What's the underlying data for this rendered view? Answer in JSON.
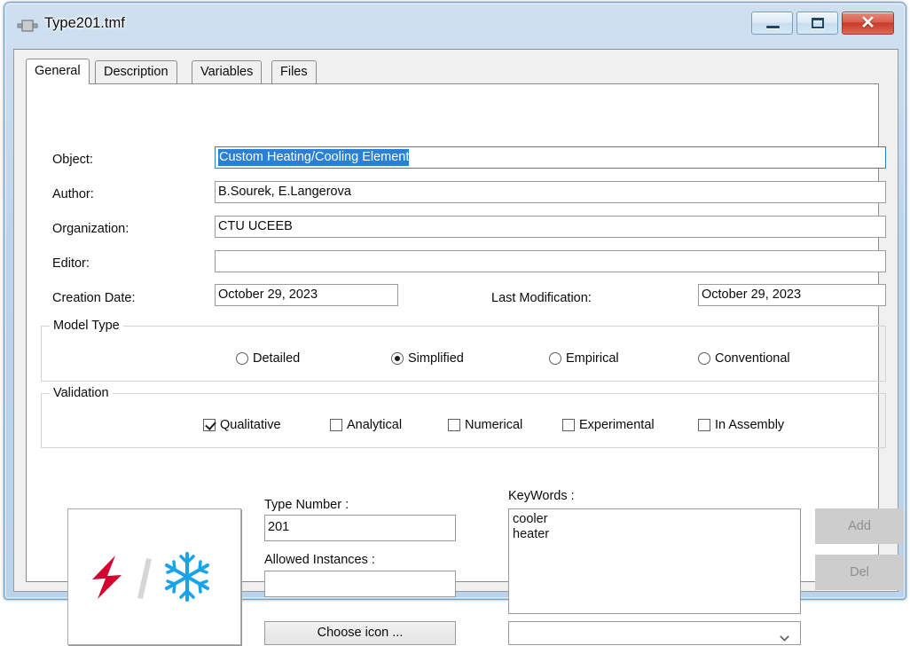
{
  "window": {
    "title": "Type201.tmf",
    "icon": "trnsys-type-icon",
    "controls": {
      "minimize": "minimize-button",
      "maximize": "maximize-button",
      "close_glyph": "✕"
    }
  },
  "tabs": [
    {
      "label": "General",
      "active": true
    },
    {
      "label": "Description",
      "active": false
    },
    {
      "label": "Variables",
      "active": false
    },
    {
      "label": "Files",
      "active": false
    }
  ],
  "fields": {
    "object": {
      "label": "Object:",
      "value": "Custom Heating/Cooling Element",
      "selected": true,
      "focused": true
    },
    "author": {
      "label": "Author:",
      "value": "B.Sourek, E.Langerova"
    },
    "organization": {
      "label": "Organization:",
      "value": "CTU UCEEB"
    },
    "editor": {
      "label": "Editor:",
      "value": ""
    },
    "creation_date": {
      "label": "Creation Date:",
      "value": "October 29, 2023"
    },
    "last_modification": {
      "label": "Last Modification:",
      "value": "October 29, 2023"
    }
  },
  "model_type": {
    "title": "Model Type",
    "options": [
      {
        "label": "Detailed",
        "checked": false
      },
      {
        "label": "Simplified",
        "checked": true
      },
      {
        "label": "Empirical",
        "checked": false
      },
      {
        "label": "Conventional",
        "checked": false
      }
    ]
  },
  "validation": {
    "title": "Validation",
    "options": [
      {
        "label": "Qualitative",
        "checked": true
      },
      {
        "label": "Analytical",
        "checked": false
      },
      {
        "label": "Numerical",
        "checked": false
      },
      {
        "label": "Experimental",
        "checked": false
      },
      {
        "label": "In Assembly",
        "checked": false
      }
    ]
  },
  "icon_panel": {
    "choose_button": "Choose icon ...",
    "art": {
      "bolt": "lightning-bolt-icon",
      "slash": "slash-divider-icon",
      "snowflake": "snowflake-icon"
    }
  },
  "type_number": {
    "label": "Type Number :",
    "value": "201"
  },
  "allowed_instances": {
    "label": "Allowed Instances :",
    "value": ""
  },
  "keywords": {
    "label": "KeyWords :",
    "items": [
      "cooler",
      "heater"
    ],
    "combo_value": "",
    "add_button": "Add",
    "del_button": "Del",
    "add_enabled": false,
    "del_enabled": false
  },
  "colors": {
    "titlebar_top": "#cfe0f0",
    "titlebar_bottom": "#b9d3ea",
    "close_button": "#c63a28",
    "selection_blue": "#2b7fd4",
    "focus_border": "#2f7fd0",
    "bolt_red": "#d4002f",
    "slash_gray": "#d3d3d3",
    "snowflake_blue": "#19a3e8",
    "disabled_gray": "#cdcdcd"
  }
}
